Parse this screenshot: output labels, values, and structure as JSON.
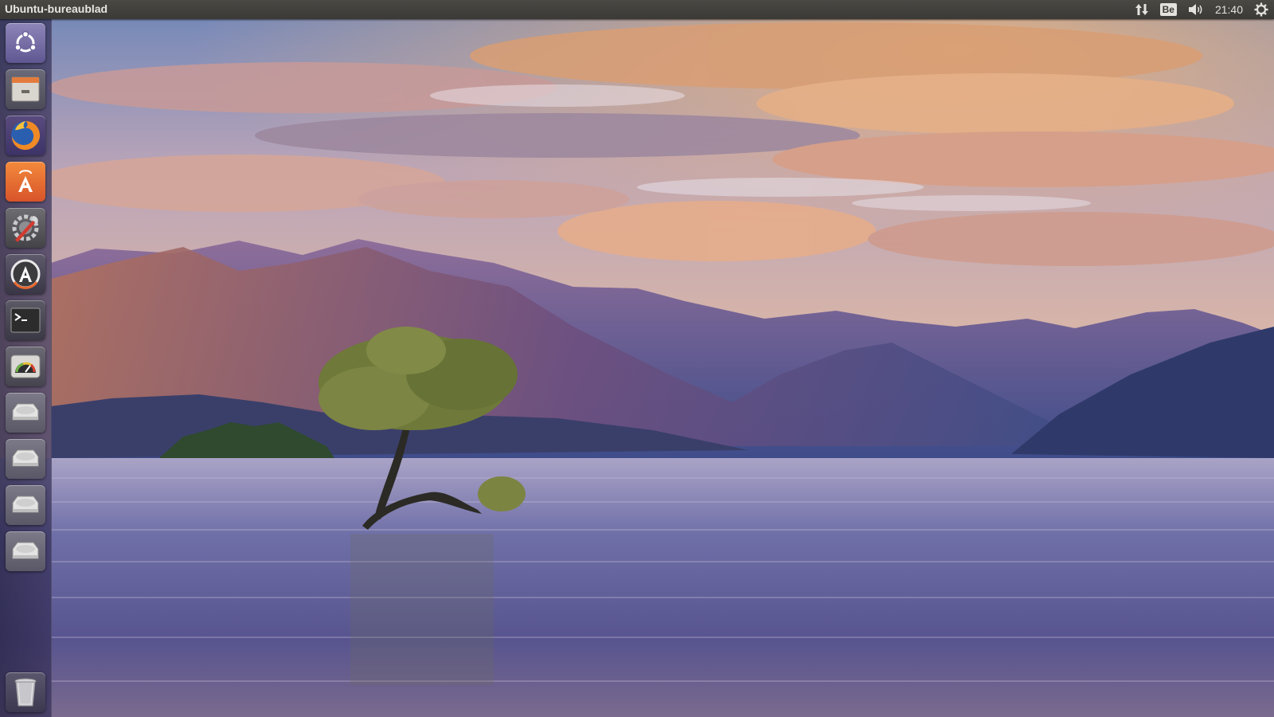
{
  "panel": {
    "title": "Ubuntu-bureaublad",
    "indicators": {
      "network_icon": "network-updown-icon",
      "keyboard_layout": "Be",
      "sound_icon": "speaker-icon",
      "time": "21:40",
      "session_icon": "gear-icon"
    }
  },
  "launcher": {
    "items": [
      {
        "icon": "ubuntu-dash-icon"
      },
      {
        "icon": "file-manager-icon"
      },
      {
        "icon": "firefox-icon"
      },
      {
        "icon": "software-center-icon"
      },
      {
        "icon": "system-settings-icon"
      },
      {
        "icon": "software-updater-icon"
      },
      {
        "icon": "terminal-icon"
      },
      {
        "icon": "system-monitor-icon"
      },
      {
        "icon": "drive-icon"
      },
      {
        "icon": "drive-icon"
      },
      {
        "icon": "drive-icon"
      },
      {
        "icon": "drive-icon"
      },
      {
        "icon": "trash-icon"
      }
    ]
  },
  "colors": {
    "panel": "#3b3a36",
    "launcher": "#2c2850",
    "software_center": "#e8672f"
  }
}
